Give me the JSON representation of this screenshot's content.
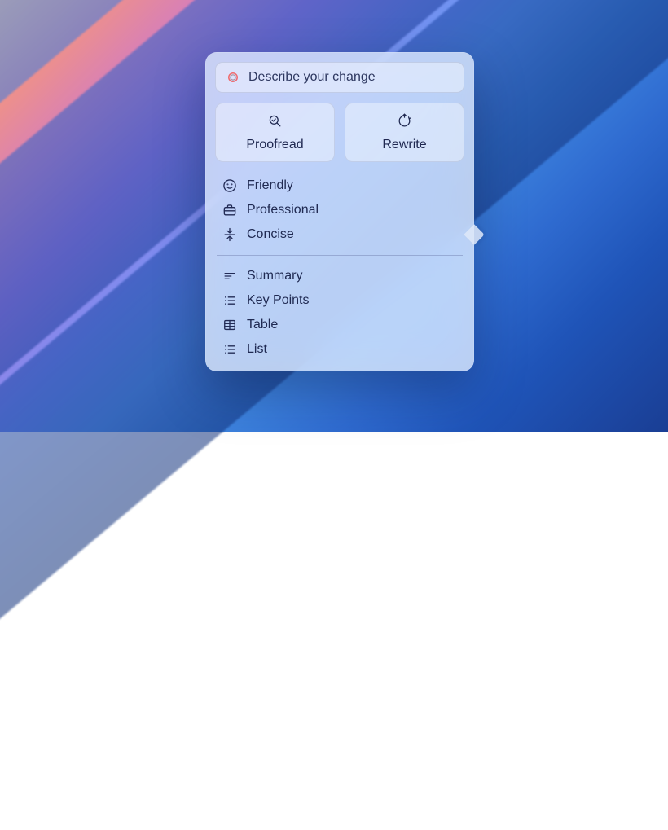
{
  "popover": {
    "describe_placeholder": "Describe your change",
    "actions": {
      "proofread": "Proofread",
      "rewrite": "Rewrite"
    },
    "tones": [
      {
        "icon": "smiley-icon",
        "label": "Friendly"
      },
      {
        "icon": "briefcase-icon",
        "label": "Professional"
      },
      {
        "icon": "compress-icon",
        "label": "Concise"
      }
    ],
    "formats": [
      {
        "icon": "summary-icon",
        "label": "Summary"
      },
      {
        "icon": "bullets-icon",
        "label": "Key Points"
      },
      {
        "icon": "table-icon",
        "label": "Table"
      },
      {
        "icon": "list-icon",
        "label": "List"
      }
    ]
  }
}
